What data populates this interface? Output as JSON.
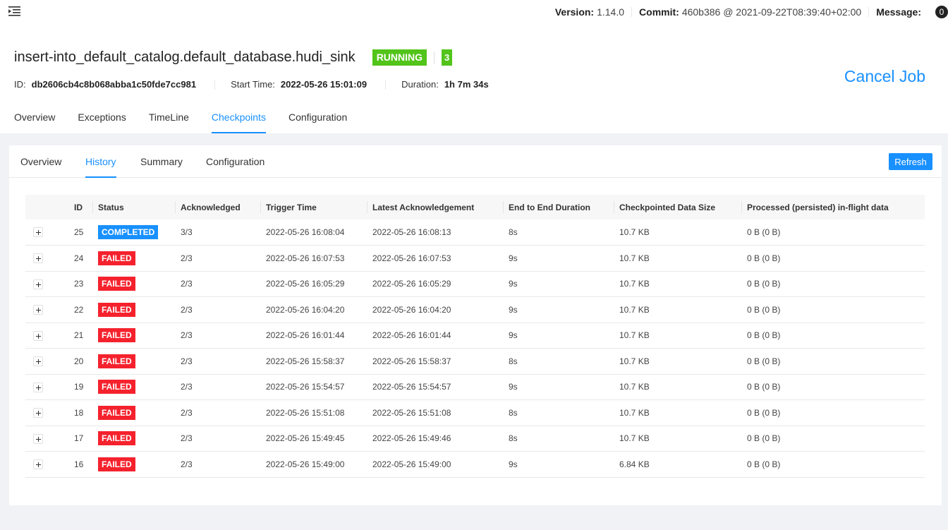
{
  "topbar": {
    "version_label": "Version:",
    "version_value": "1.14.0",
    "commit_label": "Commit:",
    "commit_value": "460b386 @ 2021-09-22T08:39:40+02:00",
    "message_label": "Message:",
    "message_count": "0"
  },
  "job": {
    "title": "insert-into_default_catalog.default_database.hudi_sink",
    "status": "RUNNING",
    "task_count": "3",
    "id_label": "ID:",
    "id_value": "db2606cb4c8b068abba1c50fde7cc981",
    "start_label": "Start Time:",
    "start_value": "2022-05-26 15:01:09",
    "duration_label": "Duration:",
    "duration_value": "1h 7m 34s",
    "cancel_label": "Cancel Job",
    "tabs": [
      "Overview",
      "Exceptions",
      "TimeLine",
      "Checkpoints",
      "Configuration"
    ],
    "active_tab": "Checkpoints"
  },
  "checkpoints": {
    "tabs": [
      "Overview",
      "History",
      "Summary",
      "Configuration"
    ],
    "active_tab": "History",
    "refresh_label": "Refresh",
    "columns": [
      "",
      "ID",
      "Status",
      "Acknowledged",
      "Trigger Time",
      "Latest Acknowledgement",
      "End to End Duration",
      "Checkpointed Data Size",
      "Processed (persisted) in-flight data"
    ],
    "rows": [
      {
        "id": "25",
        "status": "COMPLETED",
        "ack": "3/3",
        "trigger": "2022-05-26 16:08:04",
        "latest": "2022-05-26 16:08:13",
        "duration": "8s",
        "size": "10.7 KB",
        "inflight": "0 B (0 B)"
      },
      {
        "id": "24",
        "status": "FAILED",
        "ack": "2/3",
        "trigger": "2022-05-26 16:07:53",
        "latest": "2022-05-26 16:07:53",
        "duration": "9s",
        "size": "10.7 KB",
        "inflight": "0 B (0 B)"
      },
      {
        "id": "23",
        "status": "FAILED",
        "ack": "2/3",
        "trigger": "2022-05-26 16:05:29",
        "latest": "2022-05-26 16:05:29",
        "duration": "9s",
        "size": "10.7 KB",
        "inflight": "0 B (0 B)"
      },
      {
        "id": "22",
        "status": "FAILED",
        "ack": "2/3",
        "trigger": "2022-05-26 16:04:20",
        "latest": "2022-05-26 16:04:20",
        "duration": "9s",
        "size": "10.7 KB",
        "inflight": "0 B (0 B)"
      },
      {
        "id": "21",
        "status": "FAILED",
        "ack": "2/3",
        "trigger": "2022-05-26 16:01:44",
        "latest": "2022-05-26 16:01:44",
        "duration": "9s",
        "size": "10.7 KB",
        "inflight": "0 B (0 B)"
      },
      {
        "id": "20",
        "status": "FAILED",
        "ack": "2/3",
        "trigger": "2022-05-26 15:58:37",
        "latest": "2022-05-26 15:58:37",
        "duration": "8s",
        "size": "10.7 KB",
        "inflight": "0 B (0 B)"
      },
      {
        "id": "19",
        "status": "FAILED",
        "ack": "2/3",
        "trigger": "2022-05-26 15:54:57",
        "latest": "2022-05-26 15:54:57",
        "duration": "9s",
        "size": "10.7 KB",
        "inflight": "0 B (0 B)"
      },
      {
        "id": "18",
        "status": "FAILED",
        "ack": "2/3",
        "trigger": "2022-05-26 15:51:08",
        "latest": "2022-05-26 15:51:08",
        "duration": "8s",
        "size": "10.7 KB",
        "inflight": "0 B (0 B)"
      },
      {
        "id": "17",
        "status": "FAILED",
        "ack": "2/3",
        "trigger": "2022-05-26 15:49:45",
        "latest": "2022-05-26 15:49:46",
        "duration": "8s",
        "size": "10.7 KB",
        "inflight": "0 B (0 B)"
      },
      {
        "id": "16",
        "status": "FAILED",
        "ack": "2/3",
        "trigger": "2022-05-26 15:49:00",
        "latest": "2022-05-26 15:49:00",
        "duration": "9s",
        "size": "6.84 KB",
        "inflight": "0 B (0 B)"
      }
    ]
  },
  "colors": {
    "accent": "#1890ff",
    "running": "#52c41a",
    "completed": "#1890ff",
    "failed": "#f5222d"
  },
  "icons": {
    "menu": "menu-fold-icon",
    "expand": "plus-square-icon"
  }
}
